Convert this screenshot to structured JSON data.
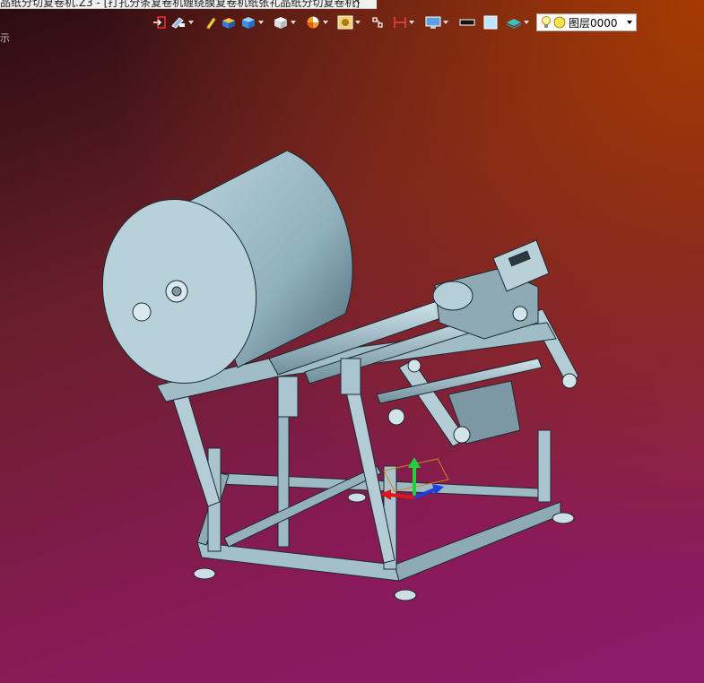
{
  "window": {
    "tab_title": "品纸分切复卷机.Z3 - [打孔分条复卷机缠绕膜复卷机纸张礼品纸分切复卷机]",
    "tab_close": "✕",
    "tab_add": "+",
    "corner_label": "示"
  },
  "toolbar": {
    "layer_label": "图层0000",
    "icons": [
      "exit-icon",
      "pen-tool-icon",
      "pencil-icon",
      "box-solid-icon",
      "cube-icon",
      "view-cube-icon",
      "pie-icon",
      "render-icon",
      "snap-icon",
      "dimension-icon",
      "display-icon",
      "line-style-icon",
      "color-swatch-icon",
      "layer-stack-icon"
    ]
  },
  "colors": {
    "machine": "#a9c4cf",
    "machine_dark": "#5e7c88",
    "axis_x": "#e0151b",
    "axis_y": "#1fd13a",
    "axis_z": "#1f3fe0"
  }
}
